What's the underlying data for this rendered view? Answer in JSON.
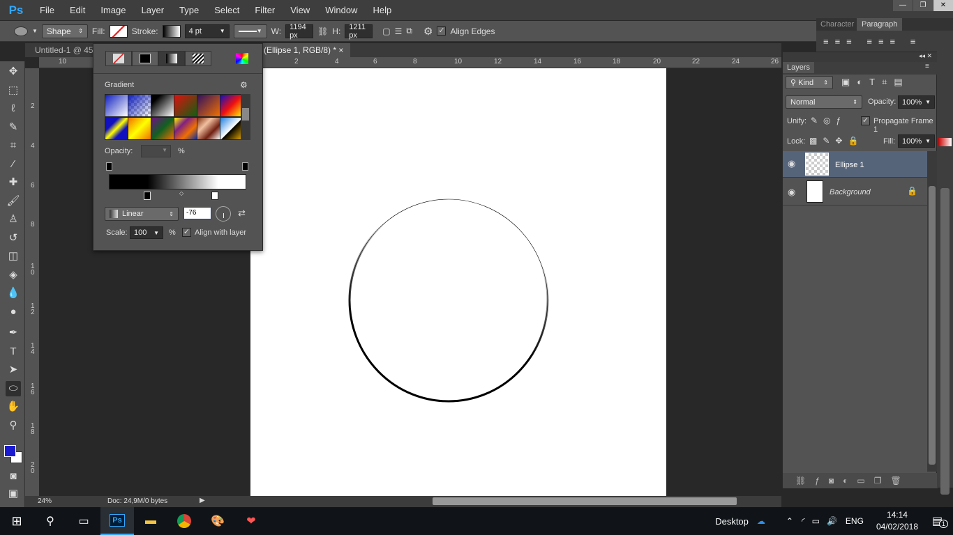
{
  "app": {
    "logo": "Ps",
    "menu": [
      "File",
      "Edit",
      "Image",
      "Layer",
      "Type",
      "Select",
      "Filter",
      "View",
      "Window",
      "Help"
    ]
  },
  "window_controls": [
    "minimize",
    "restore",
    "close"
  ],
  "options": {
    "tool_mode": "Shape",
    "fill_label": "Fill:",
    "stroke_label": "Stroke:",
    "stroke_width": "4 pt",
    "w_label": "W:",
    "w_value": "1194 px",
    "h_label": "H:",
    "h_value": "1211 px",
    "align_edges": "Align Edges",
    "align_edges_checked": true
  },
  "tabs": [
    {
      "title": "Untitled-1 @ 45,"
    },
    {
      "title": "(Ellipse 1, RGB/8) *",
      "close": "×"
    }
  ],
  "ruler_top": [
    "10",
    "2",
    "4",
    "6",
    "8",
    "10",
    "12",
    "14",
    "16",
    "18",
    "20",
    "22",
    "24",
    "26"
  ],
  "ruler_left": [
    "2",
    "4",
    "6",
    "8",
    "10",
    "12",
    "14",
    "16",
    "18",
    "20"
  ],
  "status": {
    "zoom": "24%",
    "doc": "Doc: 24,9M/0 bytes"
  },
  "gradient_panel": {
    "title": "Gradient",
    "opacity_label": "Opacity:",
    "opacity_value": "",
    "opacity_unit": "%",
    "style": "Linear",
    "angle": "-76",
    "scale_label": "Scale:",
    "scale_value": "100",
    "scale_unit": "%",
    "align_with_layer": "Align with layer",
    "align_checked": true,
    "presets": [
      "blue-white",
      "blue-transparent",
      "black-white",
      "red-green",
      "violet-orange",
      "blue-red-yellow",
      "blue-yellow-blue",
      "orange-yellow-orange",
      "violet-green-orange",
      "yellow-violet-orange-blue",
      "copper",
      "chrome"
    ]
  },
  "panels_top": {
    "tabs": [
      "Character",
      "Paragraph"
    ],
    "active": "Paragraph"
  },
  "layers": {
    "tab": "Layers",
    "filter": "Kind",
    "blend": "Normal",
    "opacity_label": "Opacity:",
    "opacity": "100%",
    "unify_label": "Unify:",
    "propagate": "Propagate Frame 1",
    "lock_label": "Lock:",
    "fill_label": "Fill:",
    "fill": "100%",
    "items": [
      {
        "name": "Ellipse 1",
        "selected": true
      },
      {
        "name": "Background",
        "locked": true
      }
    ]
  },
  "taskbar": {
    "desktop": "Desktop",
    "lang": "ENG",
    "time": "14:14",
    "date": "04/02/2018",
    "notifications": "1"
  },
  "colors": {
    "foreground": "#1a1ad0",
    "background": "#ffffff",
    "selected_layer": "#56647a",
    "ps_blue": "#31a8ff"
  }
}
